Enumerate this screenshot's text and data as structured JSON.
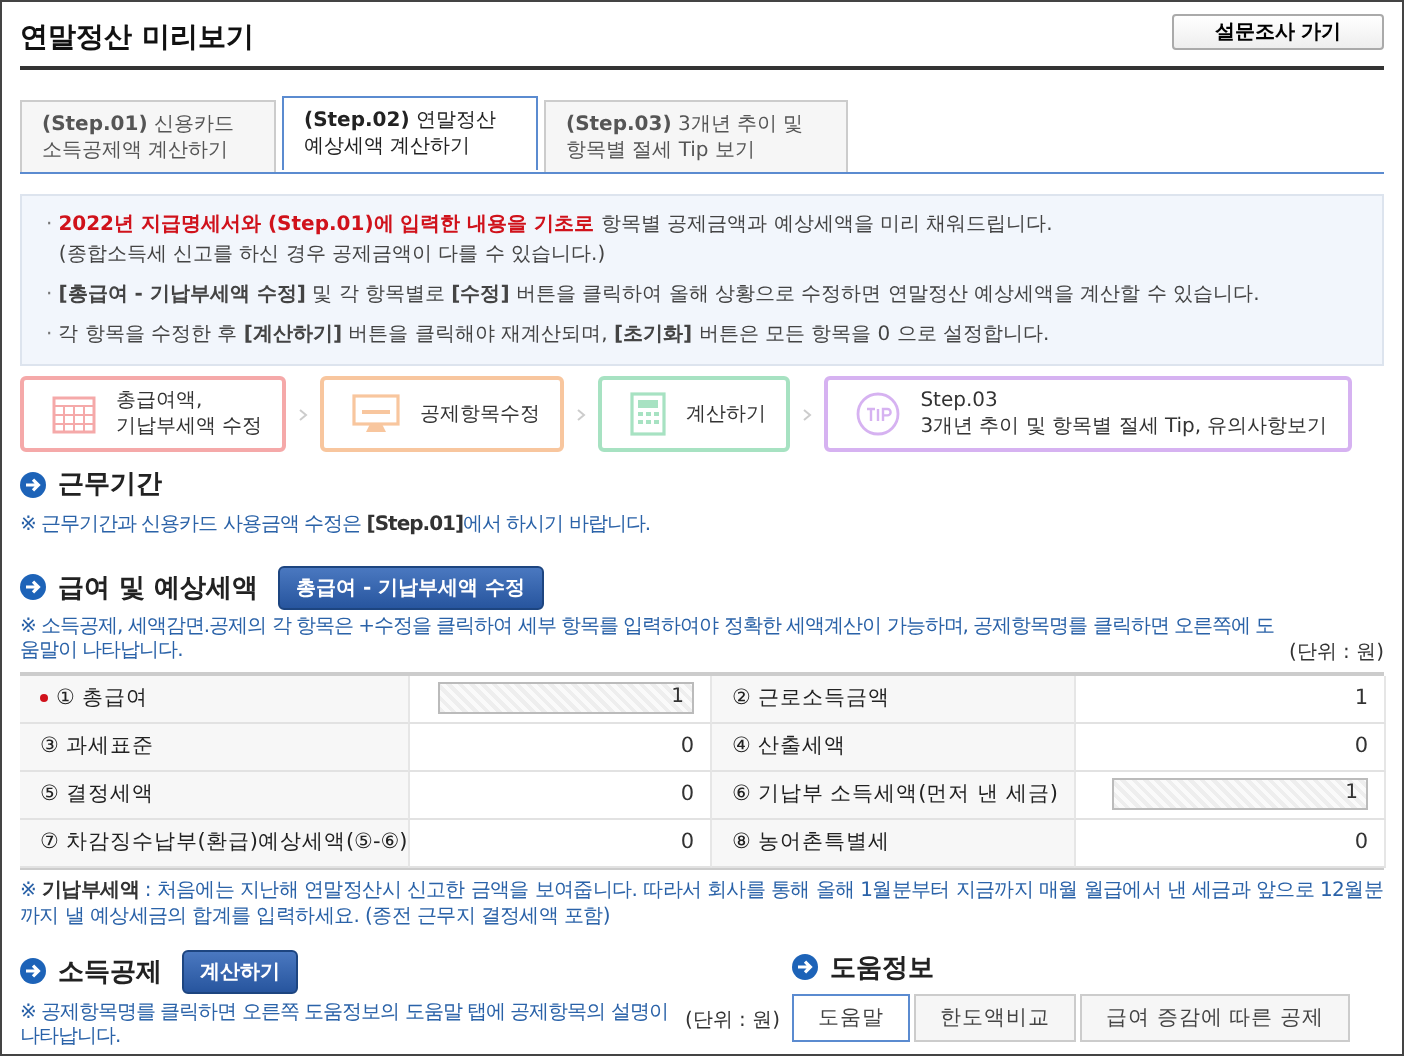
{
  "window": {
    "title": "연말정산 미리보기",
    "action": "설문조사 가기"
  },
  "tabs": [
    {
      "step": "(Step.01)",
      "label": "신용카드 소득공제액 계산하기",
      "selected": false
    },
    {
      "step": "(Step.02)",
      "label": "연말정산 예상세액 계산하기",
      "selected": true
    },
    {
      "step": "(Step.03)",
      "label": "3개년 추이 및 항목별 절세 Tip 보기",
      "selected": false
    }
  ],
  "notice": [
    {
      "bullet": "·",
      "highlight": "2022년 지급명세서와 (Step.01)에 입력한 내용을 기초로",
      "text": "항목별 공제금액과 예상세액을 미리 채워드립니다.",
      "note": "(종합소득세 신고를 하신 경우 공제금액이 다를 수 있습니다.)"
    },
    {
      "bullet": "·",
      "text": "**[총급여 - 기납부세액 수정]** 및 각 항목별로 **[수정]** 버튼을 클릭하여 올해 상황으로 수정하면 연말정산 예상세액을 계산할 수 있습니다."
    },
    {
      "bullet": "·",
      "text": "각 항목을 수정한 후 **[계산하기]** 버튼을 클릭해야 재계산되며, **[초기화]** 버튼은 모든 항목을 0 으로 설정합니다."
    }
  ],
  "steps": [
    {
      "kind": "calendar",
      "label": "총급여액,\n기납부세액 수정",
      "color": "#f5a9a9"
    },
    {
      "kind": "monitor",
      "label": "공제항목수정",
      "color": "#f8c69e"
    },
    {
      "kind": "calculator",
      "label": "계산하기",
      "color": "#a7e2c2"
    },
    {
      "kind": "tip",
      "label": "Step.03\n3개년 추이 및 항목별 절세 Tip, 유의사항보기",
      "color": "#d6b2f1"
    }
  ],
  "work_period": {
    "title": "근무기간",
    "note": "※ 근무기간과 신용카드 사용금액 수정은 **[Step.01]**에서 하시기 바랍니다."
  },
  "salary": {
    "title": "급여 및 예상세액",
    "button": "총급여 - 기납부세액 수정",
    "note": "※ 소득공제, 세액감면.공제의 각 항목은 +수정을 클릭하여 세부 항목를 입력하여야 정확한 세액계산이 가능하며, 공제항목명를 클릭하면 오른쪽에 도움말이 나타납니다.",
    "unit": "(단위 : 원)",
    "cells": [
      {
        "label": "① 총급여",
        "required": true,
        "kind": "input",
        "value": "1"
      },
      {
        "label": "② 근로소득금액",
        "required": false,
        "kind": "text",
        "value": "1"
      },
      {
        "label": "③ 과세표준",
        "required": false,
        "kind": "text",
        "value": "0"
      },
      {
        "label": "④ 산출세액",
        "required": false,
        "kind": "text",
        "value": "0"
      },
      {
        "label": "⑤ 결정세액",
        "required": false,
        "kind": "text",
        "value": "0"
      },
      {
        "label": "⑥ 기납부 소득세액(먼저 낸 세금)",
        "required": false,
        "kind": "input",
        "value": "1"
      },
      {
        "label": "⑦ 차감징수납부(환급)예상세액(⑤-⑥)",
        "required": false,
        "kind": "text",
        "value": "0"
      },
      {
        "label": "⑧ 농어촌특별세",
        "required": false,
        "kind": "text",
        "value": "0"
      }
    ],
    "footnote": "※ **기납부세액** : 처음에는 지난해 연말정산시 신고한 금액을 보여줍니다. 따라서 회사를 통해 올해 1월분부터 지금까지 매월 월급에서 낸 세금과 앞으로 12월분까지 낼 예상세금의 합계를 입력하세요. (종전 근무지 결정세액 포함)"
  },
  "deduction": {
    "title": "소득공제",
    "button": "계산하기",
    "note": "※ 공제항목명를 클릭하면 오른쪽 도움정보의 도움말 탭에 공제항목의 설명이 나타납니다.",
    "unit": "(단위 : 원)"
  },
  "help": {
    "title": "도움정보",
    "tabs": [
      {
        "label": "도움말",
        "selected": true
      },
      {
        "label": "한도액비교",
        "selected": false
      },
      {
        "label": "급여 증감에 따른 공제",
        "selected": false
      }
    ]
  }
}
